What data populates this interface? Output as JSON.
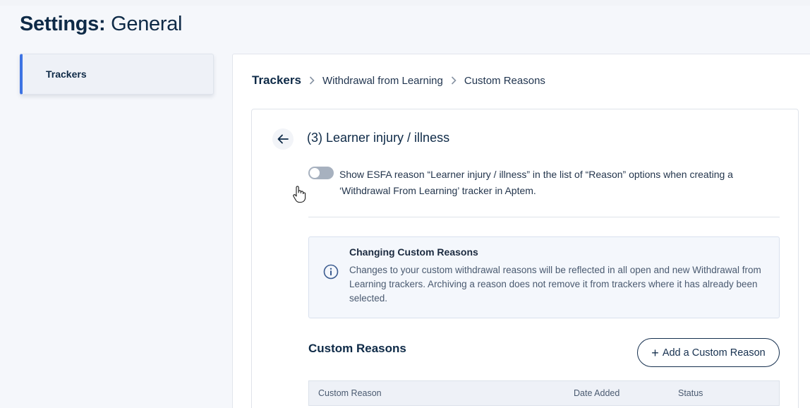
{
  "header": {
    "title_bold": "Settings:",
    "title_light": " General"
  },
  "sidebar": {
    "items": [
      {
        "label": "Trackers",
        "active": true
      }
    ]
  },
  "breadcrumb": {
    "root": "Trackers",
    "items": [
      "Withdrawal from Learning",
      "Custom Reasons"
    ]
  },
  "reason": {
    "title": "(3) Learner injury / illness",
    "toggle_on": false,
    "toggle_text": "Show ESFA reason “Learner injury / illness” in the list of “Reason” options when creating a ‘Withdrawal From Learning’ tracker in Aptem."
  },
  "info": {
    "title": "Changing Custom Reasons",
    "text": "Changes to your custom withdrawal reasons will be reflected in all open and new Withdrawal from Learning trackers. Archiving a reason does not remove it from trackers where it has already been selected."
  },
  "custom_reasons": {
    "title": "Custom Reasons",
    "add_button": "Add a Custom Reason",
    "columns": [
      "Custom Reason",
      "Date Added",
      "Status"
    ]
  },
  "colors": {
    "accent": "#3d73e3",
    "navy": "#0e2a47"
  },
  "icons": {
    "back": "arrow-left-icon",
    "separator": "chevron-right-icon",
    "info": "info-icon",
    "add": "plus-icon"
  }
}
